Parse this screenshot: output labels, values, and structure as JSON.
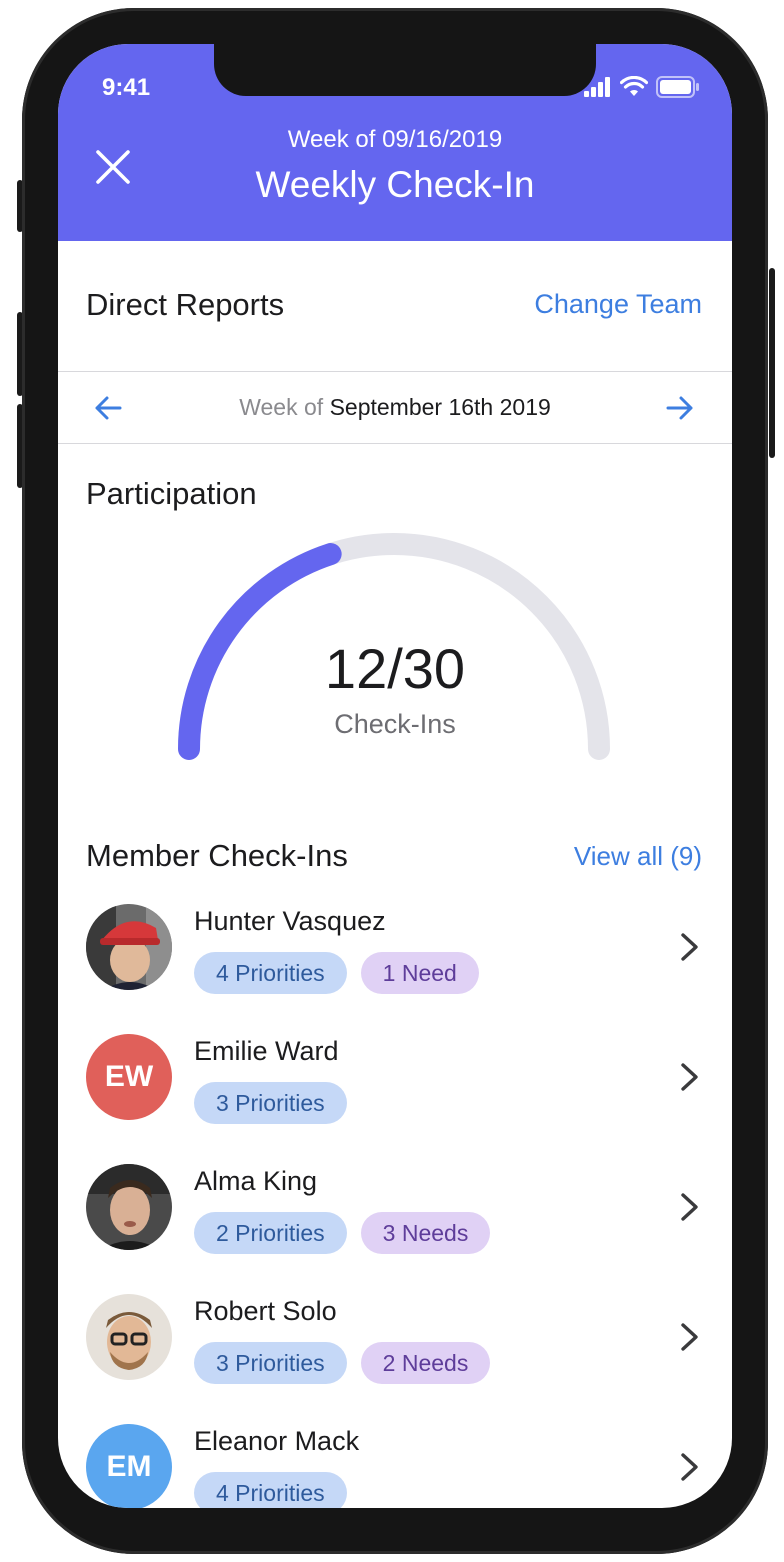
{
  "status_bar": {
    "time": "9:41"
  },
  "header": {
    "subtitle": "Week of 09/16/2019",
    "title": "Weekly Check-In",
    "background": "#6466ef"
  },
  "reports": {
    "title": "Direct Reports",
    "action_label": "Change Team"
  },
  "week_nav": {
    "prefix": "Week of",
    "date": "September 16th 2019"
  },
  "participation": {
    "title": "Participation",
    "count_text": "12/30",
    "label": "Check-Ins",
    "completed": 12,
    "total": 30,
    "fill_color": "#6466ef",
    "track_color": "#e4e4ea"
  },
  "members": {
    "title": "Member Check-Ins",
    "view_all_label": "View all (9)",
    "items": [
      {
        "name": "Hunter Vasquez",
        "avatar": "photo",
        "priorities": "4 Priorities",
        "needs": "1 Need"
      },
      {
        "name": "Emilie Ward",
        "avatar": "initials",
        "initials": "EW",
        "avatar_color": "#e0605a",
        "priorities": "3 Priorities"
      },
      {
        "name": "Alma King",
        "avatar": "photo",
        "priorities": "2 Priorities",
        "needs": "3 Needs"
      },
      {
        "name": "Robert Solo",
        "avatar": "photo",
        "priorities": "3 Priorities",
        "needs": "2 Needs"
      },
      {
        "name": "Eleanor Mack",
        "avatar": "initials",
        "initials": "EM",
        "avatar_color": "#5aa6ef",
        "priorities": "4 Priorities"
      }
    ]
  },
  "accent_color": "#3d7ee0"
}
